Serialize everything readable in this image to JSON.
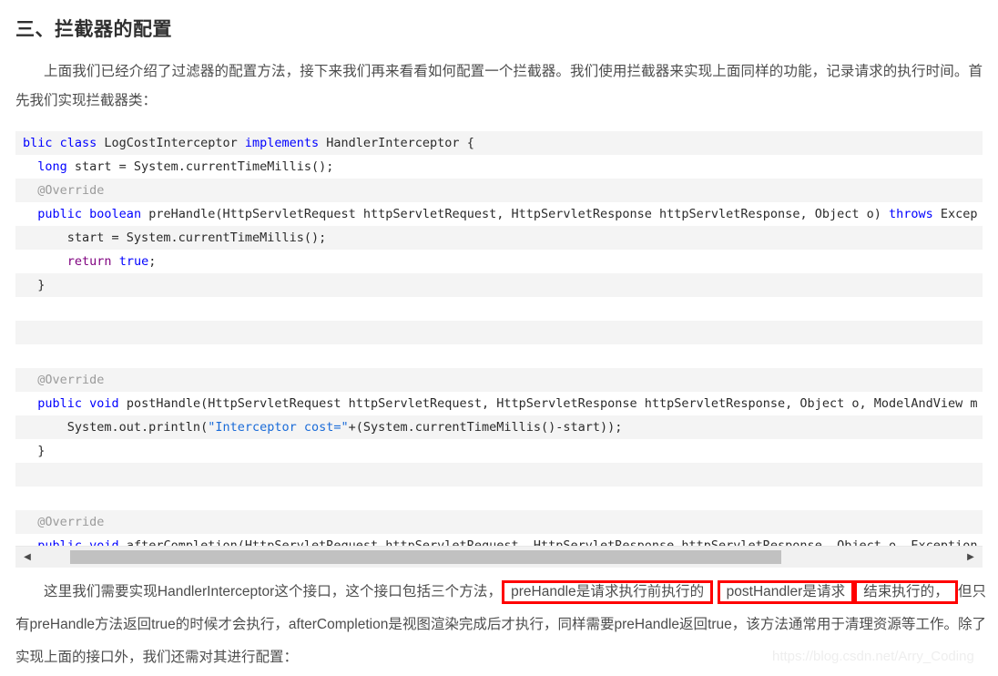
{
  "heading": "三、拦截器的配置",
  "intro_paragraph": "上面我们已经介绍了过滤器的配置方法，接下来我们再来看看如何配置一个拦截器。我们使用拦截器来实现上面同样的功能，记录请求的执行时间。首先我们实现拦截器类：",
  "code": {
    "language": "java",
    "lines": [
      {
        "stripe": true,
        "tokens": [
          {
            "text": "blic ",
            "style": "kw-blue"
          },
          {
            "text": "class ",
            "style": "kw-blue"
          },
          {
            "text": "LogCostInterceptor ",
            "style": "kw-plain"
          },
          {
            "text": "implements ",
            "style": "kw-blue"
          },
          {
            "text": "HandlerInterceptor {",
            "style": "kw-plain"
          }
        ]
      },
      {
        "stripe": false,
        "tokens": [
          {
            "text": "  ",
            "style": "kw-plain"
          },
          {
            "text": "long",
            "style": "kw-blue"
          },
          {
            "text": " start = System.currentTimeMillis();",
            "style": "kw-plain"
          }
        ]
      },
      {
        "stripe": true,
        "tokens": [
          {
            "text": "  @Override",
            "style": "kw-anno"
          }
        ]
      },
      {
        "stripe": false,
        "tokens": [
          {
            "text": "  ",
            "style": "kw-plain"
          },
          {
            "text": "public ",
            "style": "kw-blue"
          },
          {
            "text": "boolean",
            "style": "kw-blue"
          },
          {
            "text": " preHandle(HttpServletRequest httpServletRequest, HttpServletResponse httpServletResponse, Object o) ",
            "style": "kw-plain"
          },
          {
            "text": "throws",
            "style": "kw-blue"
          },
          {
            "text": " Excep",
            "style": "kw-plain"
          }
        ]
      },
      {
        "stripe": true,
        "tokens": [
          {
            "text": "      start = System.currentTimeMillis();",
            "style": "kw-plain"
          }
        ]
      },
      {
        "stripe": false,
        "tokens": [
          {
            "text": "      ",
            "style": "kw-plain"
          },
          {
            "text": "return",
            "style": "kw-purple"
          },
          {
            "text": " ",
            "style": "kw-plain"
          },
          {
            "text": "true",
            "style": "kw-blue"
          },
          {
            "text": ";",
            "style": "kw-plain"
          }
        ]
      },
      {
        "stripe": true,
        "tokens": [
          {
            "text": "  }",
            "style": "kw-plain"
          }
        ]
      },
      {
        "stripe": false,
        "tokens": [
          {
            "text": "",
            "style": "kw-plain"
          }
        ]
      },
      {
        "stripe": true,
        "tokens": [
          {
            "text": "",
            "style": "kw-plain"
          }
        ]
      },
      {
        "stripe": false,
        "tokens": [
          {
            "text": "",
            "style": "kw-plain"
          }
        ]
      },
      {
        "stripe": true,
        "tokens": [
          {
            "text": "  @Override",
            "style": "kw-anno"
          }
        ]
      },
      {
        "stripe": false,
        "tokens": [
          {
            "text": "  ",
            "style": "kw-plain"
          },
          {
            "text": "public ",
            "style": "kw-blue"
          },
          {
            "text": "void",
            "style": "kw-blue"
          },
          {
            "text": " postHandle(HttpServletRequest httpServletRequest, HttpServletResponse httpServletResponse, Object o, ModelAndView m",
            "style": "kw-plain"
          }
        ]
      },
      {
        "stripe": true,
        "tokens": [
          {
            "text": "      System.out.println(",
            "style": "kw-plain"
          },
          {
            "text": "\"Interceptor cost=\"",
            "style": "kw-str"
          },
          {
            "text": "+(System.currentTimeMillis()-start));",
            "style": "kw-plain"
          }
        ]
      },
      {
        "stripe": false,
        "tokens": [
          {
            "text": "  }",
            "style": "kw-plain"
          }
        ]
      },
      {
        "stripe": true,
        "tokens": [
          {
            "text": "",
            "style": "kw-plain"
          }
        ]
      },
      {
        "stripe": false,
        "tokens": [
          {
            "text": "",
            "style": "kw-plain"
          }
        ]
      },
      {
        "stripe": true,
        "tokens": [
          {
            "text": "  @Override",
            "style": "kw-anno"
          }
        ]
      },
      {
        "stripe": false,
        "tokens": [
          {
            "text": "  ",
            "style": "kw-plain"
          },
          {
            "text": "public ",
            "style": "kw-blue"
          },
          {
            "text": "void",
            "style": "kw-blue"
          },
          {
            "text": " afterCompletion(HttpServletRequest httpServletRequest, HttpServletResponse httpServletResponse, Object o, Exception",
            "style": "kw-plain"
          }
        ]
      },
      {
        "stripe": true,
        "tokens": [
          {
            "text": "  }",
            "style": "kw-plain"
          }
        ]
      },
      {
        "stripe": false,
        "tokens": [
          {
            "text": "",
            "style": "kw-plain"
          }
        ]
      },
      {
        "stripe": true,
        "tokens": [
          {
            "text": "",
            "style": "kw-plain"
          }
        ]
      }
    ]
  },
  "scrollbar": {
    "left_arrow": "◀",
    "right_arrow": "▶"
  },
  "outro": {
    "seg1": "这里我们需要实现HandlerInterceptor这个接口，这个接口包括三个方法，",
    "box1": "preHandle是请求执行前执行的",
    "sep1": " ",
    "box2": "postHandler是请求",
    "box3": "结束执行的，",
    "seg2": "但只有preHandle方法返回true的时候才会执行，afterCompletion是视图渲染完成后才执行，同样需要preHandle返回true，该方法通常用于清理资源等工作。除了实现上面的接口外，我们还需对其进行配置："
  },
  "watermark": "https://blog.csdn.net/Arry_Coding",
  "colors": {
    "highlight_box": "#ff0000",
    "keyword_blue": "#0000ff",
    "keyword_purple": "#7f007f",
    "string_blue": "#1a6bd8",
    "annotation_gray": "#9b9b9b",
    "code_stripe": "#f4f4f4",
    "scrollbar_thumb": "#c1c1c1"
  }
}
